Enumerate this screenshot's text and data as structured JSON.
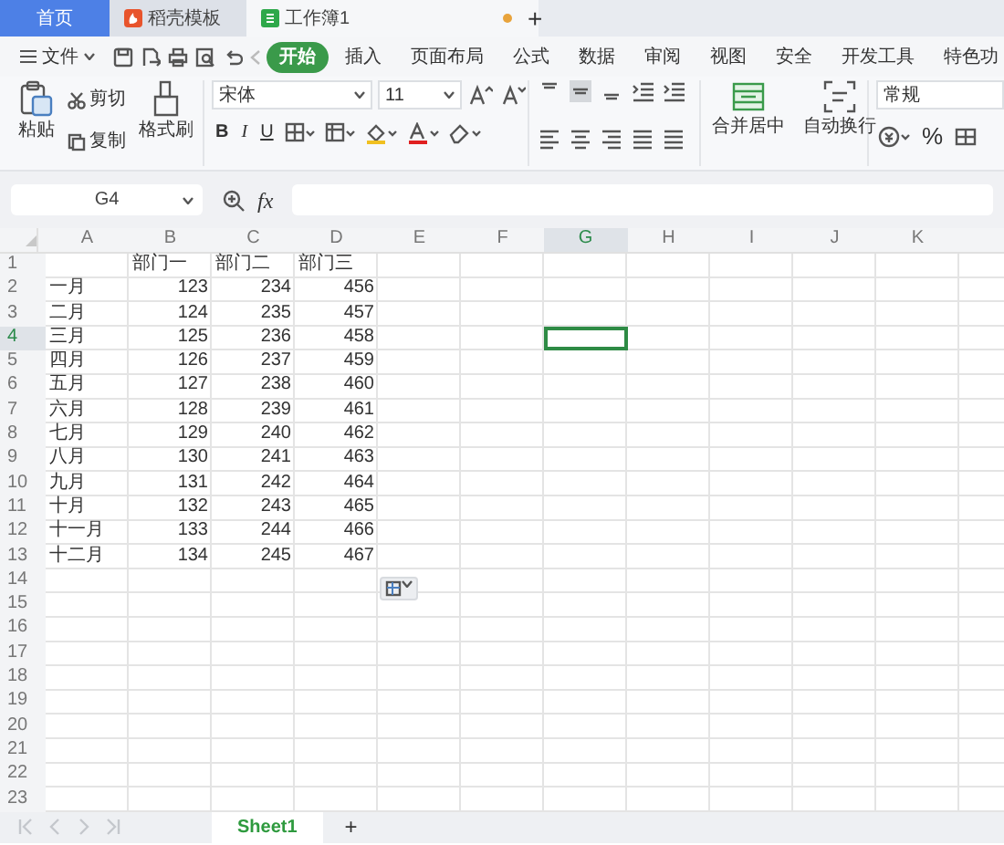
{
  "tabs": [
    {
      "kind": "home",
      "label": "首页",
      "selected": false
    },
    {
      "kind": "template",
      "label": "稻壳模板",
      "selected": false
    },
    {
      "kind": "sheet",
      "label": "工作簿1",
      "selected": true
    }
  ],
  "new_tab": "+",
  "menu": {
    "file": "文件",
    "items": [
      {
        "label": "开始",
        "selected": true
      },
      {
        "label": "插入",
        "selected": false
      },
      {
        "label": "页面布局",
        "selected": false
      },
      {
        "label": "公式",
        "selected": false
      },
      {
        "label": "数据",
        "selected": false
      },
      {
        "label": "审阅",
        "selected": false
      },
      {
        "label": "视图",
        "selected": false
      },
      {
        "label": "安全",
        "selected": false
      },
      {
        "label": "开发工具",
        "selected": false
      },
      {
        "label": "特色功",
        "selected": false
      }
    ]
  },
  "ribbon": {
    "paste": "粘贴",
    "cut": "剪切",
    "copy": "复制",
    "format_painter": "格式刷",
    "font": "宋体",
    "font_size": "11",
    "bold": "B",
    "italic": "I",
    "underline": "U",
    "merge": "合并居中",
    "wrap": "自动换行",
    "number_format": "常规",
    "percent": "%"
  },
  "formula_bar": {
    "name_box": "G4",
    "fx": "fx"
  },
  "columns": [
    {
      "label": "A",
      "selected": false
    },
    {
      "label": "B",
      "selected": false
    },
    {
      "label": "C",
      "selected": false
    },
    {
      "label": "D",
      "selected": false
    },
    {
      "label": "E",
      "selected": false
    },
    {
      "label": "F",
      "selected": false
    },
    {
      "label": "G",
      "selected": true
    },
    {
      "label": "H",
      "selected": false
    },
    {
      "label": "I",
      "selected": false
    },
    {
      "label": "J",
      "selected": false
    },
    {
      "label": "K",
      "selected": false
    }
  ],
  "rows": [
    {
      "number": "1",
      "selected": false,
      "headers": [
        "部门一",
        "部门二",
        "部门三"
      ]
    },
    {
      "number": "2",
      "selected": false,
      "label": "一月",
      "values": [
        "123",
        "234",
        "456"
      ]
    },
    {
      "number": "3",
      "selected": false,
      "label": "二月",
      "values": [
        "124",
        "235",
        "457"
      ]
    },
    {
      "number": "4",
      "selected": true,
      "label": "三月",
      "values": [
        "125",
        "236",
        "458"
      ]
    },
    {
      "number": "5",
      "selected": false,
      "label": "四月",
      "values": [
        "126",
        "237",
        "459"
      ]
    },
    {
      "number": "6",
      "selected": false,
      "label": "五月",
      "values": [
        "127",
        "238",
        "460"
      ]
    },
    {
      "number": "7",
      "selected": false,
      "label": "六月",
      "values": [
        "128",
        "239",
        "461"
      ]
    },
    {
      "number": "8",
      "selected": false,
      "label": "七月",
      "values": [
        "129",
        "240",
        "462"
      ]
    },
    {
      "number": "9",
      "selected": false,
      "label": "八月",
      "values": [
        "130",
        "241",
        "463"
      ]
    },
    {
      "number": "10",
      "selected": false,
      "label": "九月",
      "values": [
        "131",
        "242",
        "464"
      ]
    },
    {
      "number": "11",
      "selected": false,
      "label": "十月",
      "values": [
        "132",
        "243",
        "465"
      ]
    },
    {
      "number": "12",
      "selected": false,
      "label": "十一月",
      "values": [
        "133",
        "244",
        "466"
      ]
    },
    {
      "number": "13",
      "selected": false,
      "label": "十二月",
      "values": [
        "134",
        "245",
        "467"
      ]
    },
    {
      "number": "14",
      "selected": false
    },
    {
      "number": "15",
      "selected": false
    },
    {
      "number": "16",
      "selected": false
    },
    {
      "number": "17",
      "selected": false
    },
    {
      "number": "18",
      "selected": false
    },
    {
      "number": "19",
      "selected": false
    },
    {
      "number": "20",
      "selected": false
    },
    {
      "number": "21",
      "selected": false
    },
    {
      "number": "22",
      "selected": false
    },
    {
      "number": "23",
      "selected": false
    }
  ],
  "sheets": [
    {
      "label": "Sheet1",
      "selected": true
    }
  ],
  "add_sheet": "+"
}
